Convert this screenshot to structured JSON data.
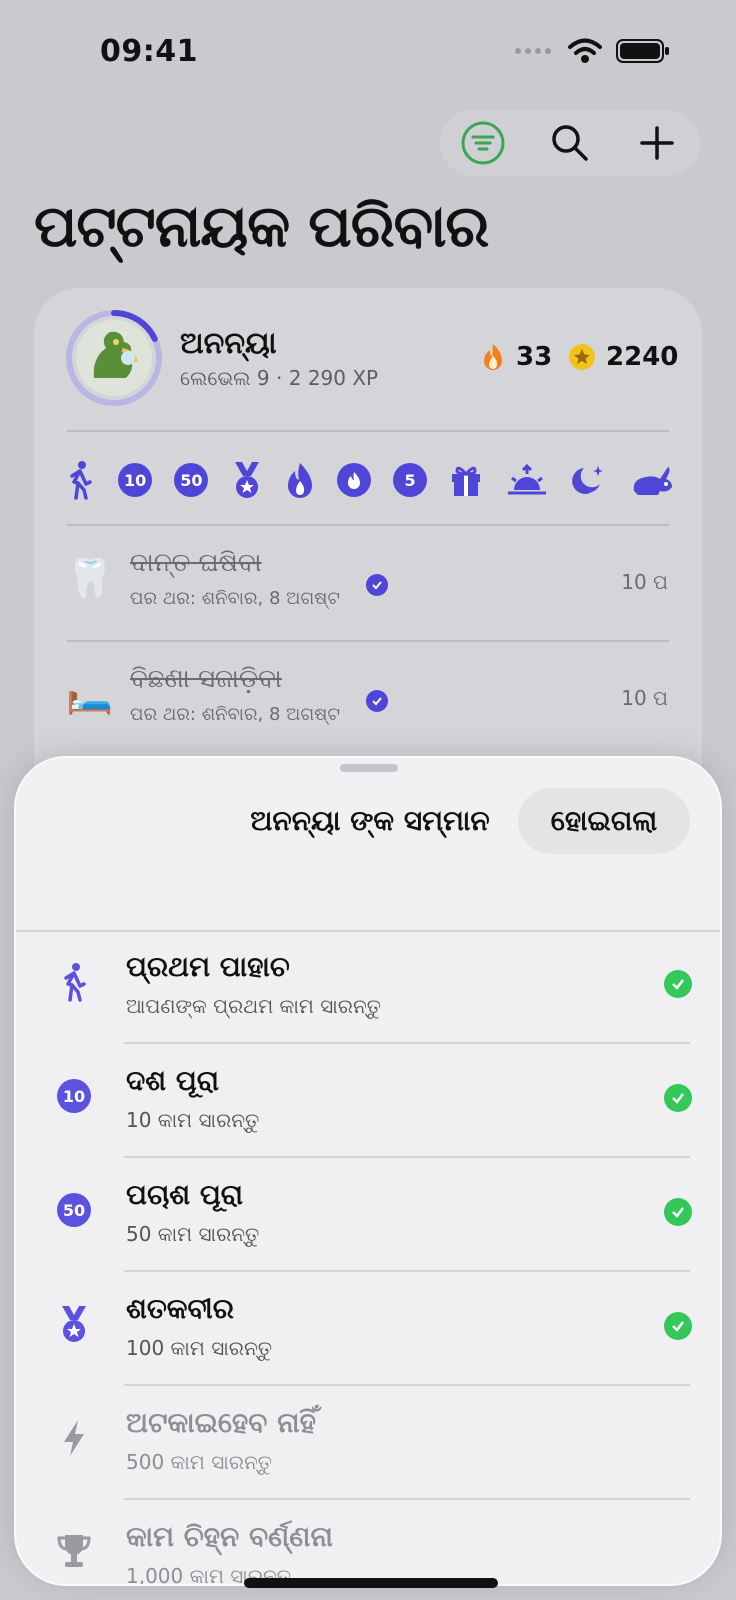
{
  "status": {
    "time": "09:41"
  },
  "page": {
    "title": "ପଟ୍ଟନାୟକ ପରିବାର"
  },
  "profile": {
    "name": "ଅନନ୍ୟା",
    "level": "ଲେଭେଲ 9 · 2 290 XP",
    "streak": "33",
    "coins": "2240",
    "level_progress": 0.18
  },
  "tasks": [
    {
      "emoji": "🦷",
      "title": "ଦାନ୍ତ ଘଷିବା",
      "subtitle": "ପର ଥର: ଶନିବାର, 8 ଅଗଷ୍ଟ",
      "points": "10 ପ"
    },
    {
      "emoji": "🛏️",
      "title": "ବିଛଣା ସଜାଡ଼ିବା",
      "subtitle": "ପର ଥର: ଶନିବାର, 8 ଅଗଷ୍ଟ",
      "points": "10 ପ"
    }
  ],
  "badges": [
    "walk-icon",
    "10",
    "50",
    "medal-icon",
    "fire-icon",
    "flame-icon",
    "5",
    "gift-icon",
    "sunrise-icon",
    "moon-icon",
    "rabbit-icon"
  ],
  "sheet": {
    "title": "ଅନନ୍ୟା ଙ୍କ ସମ୍ମାନ",
    "done": "ହୋଇଗଲା",
    "achievements": [
      {
        "icon": "walk-icon",
        "title": "ପ୍ରଥମ ପାହାଚ",
        "subtitle": "ଆପଣଙ୍କ ପ୍ରଥମ କାମ ସାରନ୍ତୁ",
        "earned": true
      },
      {
        "icon": "10",
        "title": "ଦଶ ପୂରା",
        "subtitle": "10 କାମ ସାରନ୍ତୁ",
        "earned": true
      },
      {
        "icon": "50",
        "title": "ପଚାଶ ପୂରା",
        "subtitle": "50 କାମ ସାରନ୍ତୁ",
        "earned": true
      },
      {
        "icon": "medal-icon",
        "title": "ଶତକବୀର",
        "subtitle": "100 କାମ ସାରନ୍ତୁ",
        "earned": true
      },
      {
        "icon": "bolt-icon",
        "title": "ଅଟକାଇହେବ ନାହିଁ",
        "subtitle": "500 କାମ ସାରନ୍ତୁ",
        "earned": false
      },
      {
        "icon": "trophy-icon",
        "title": "କାମ ଚିହ୍ନ ବର୍ଣ୍ଣନା",
        "subtitle": "1,000 କାମ ସାରନ୍ତୁ",
        "earned": false
      }
    ]
  },
  "colors": {
    "accent": "#4f46d8",
    "success": "#34c759",
    "filter": "#3aa655",
    "fire": "#f2811d",
    "coin": "#f3c21b"
  }
}
